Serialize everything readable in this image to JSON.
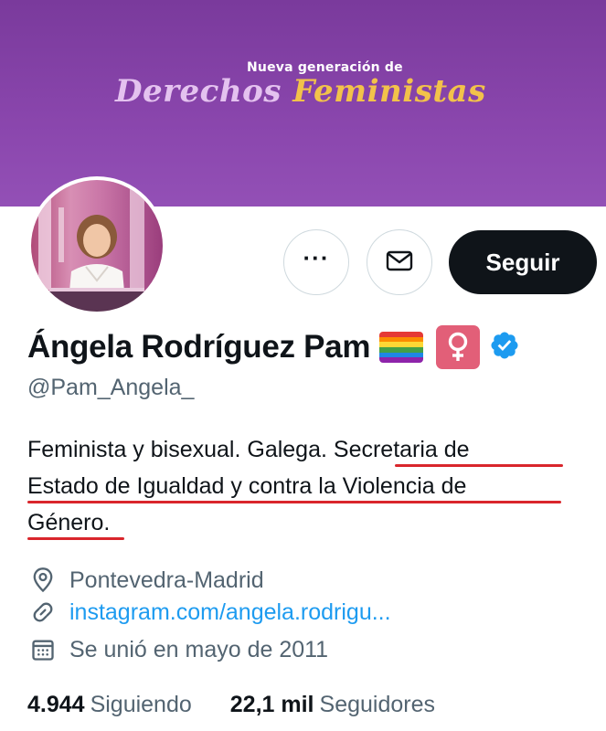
{
  "banner": {
    "pretitle": "Nueva generación de",
    "title_word1": "Derechos",
    "title_word2": "Feministas",
    "color_word1": "#e4c2ef",
    "color_word2": "#f2c24a",
    "background": "#8a46ad"
  },
  "profile": {
    "display_name": "Ángela Rodríguez Pam",
    "handle": "@Pam_Angela_",
    "emoji_icons": [
      "rainbow-flag-icon",
      "female-sign-icon",
      "verified-badge-icon"
    ],
    "bio": {
      "part1": "Feminista y bisexual. Galega. ",
      "part2": "Secretaria de",
      "part3": "Estado de Igualdad y contra la Violencia de",
      "part4": "Género",
      "part5": "."
    },
    "underline_color": "#d9262c",
    "location": "Pontevedra-Madrid",
    "website": "instagram.com/angela.rodrigu...",
    "joined": "Se unió en mayo de 2011"
  },
  "actions": {
    "more_label": "···",
    "message_icon": "envelope-icon",
    "follow_label": "Seguir"
  },
  "stats": {
    "following_count": "4.944",
    "following_label": "Siguiendo",
    "followers_count": "22,1 mil",
    "followers_label": "Seguidores"
  },
  "colors": {
    "text_primary": "#0f1419",
    "text_secondary": "#536471",
    "link": "#1d9bf0",
    "verified": "#1d9bf0"
  }
}
